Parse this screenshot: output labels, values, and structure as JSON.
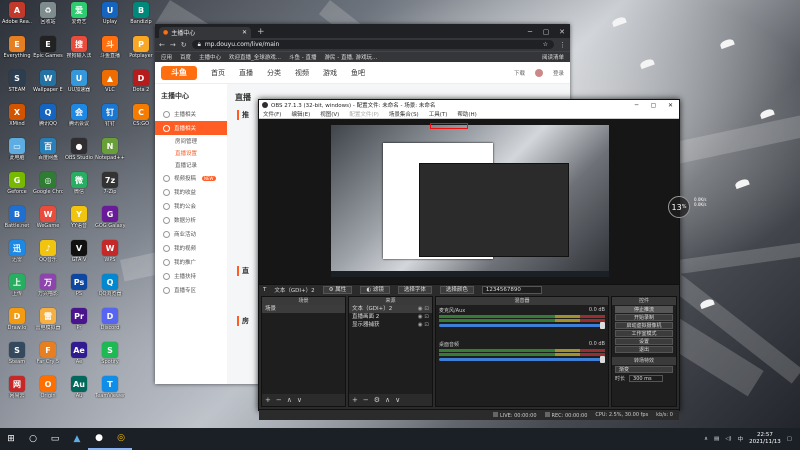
{
  "desktop": {
    "icons": [
      {
        "label": "Adobe Rea...",
        "color": "#c0392b",
        "glyph": "A"
      },
      {
        "label": "Everything",
        "color": "#e67e22",
        "glyph": "E"
      },
      {
        "label": "STEAM",
        "color": "#2c3e50",
        "glyph": "S"
      },
      {
        "label": "XMind",
        "color": "#d35400",
        "glyph": "X"
      },
      {
        "label": "此电脑",
        "color": "#5dade2",
        "glyph": "▭"
      },
      {
        "label": "Geforce",
        "color": "#76b900",
        "glyph": "G"
      },
      {
        "label": "Battle.net",
        "color": "#1f6fd1",
        "glyph": "B"
      },
      {
        "label": "迅雷",
        "color": "#1e88e5",
        "glyph": "迅"
      },
      {
        "label": "上传",
        "color": "#27ae60",
        "glyph": "上"
      },
      {
        "label": "Draw.io",
        "color": "#f39c12",
        "glyph": "D"
      },
      {
        "label": "Steam",
        "color": "#34495e",
        "glyph": "S"
      },
      {
        "label": "网易云",
        "color": "#c62828",
        "glyph": "网"
      },
      {
        "label": "回收站",
        "color": "#7f8c8d",
        "glyph": "♻"
      },
      {
        "label": "Epic Games",
        "color": "#222",
        "glyph": "E"
      },
      {
        "label": "Wallpaper Engine",
        "color": "#2471a3",
        "glyph": "W"
      },
      {
        "label": "腾讯QQ",
        "color": "#1565c0",
        "glyph": "Q"
      },
      {
        "label": "百度网盘",
        "color": "#2980b9",
        "glyph": "百"
      },
      {
        "label": "Google Chrome",
        "color": "#2e7d32",
        "glyph": "◎"
      },
      {
        "label": "WeGame",
        "color": "#e74c3c",
        "glyph": "W"
      },
      {
        "label": "QQ音乐",
        "color": "#f1c40f",
        "glyph": "♪"
      },
      {
        "label": "万兴喵影",
        "color": "#8e44ad",
        "glyph": "万"
      },
      {
        "label": "雷电模拟器",
        "color": "#f5b041",
        "glyph": "雷"
      },
      {
        "label": "Far Cry 5",
        "color": "#e67e22",
        "glyph": "F"
      },
      {
        "label": "Origin",
        "color": "#ff6f00",
        "glyph": "O"
      },
      {
        "label": "爱奇艺",
        "color": "#2ecc71",
        "glyph": "爱"
      },
      {
        "label": "搜狗输入法",
        "color": "#e74c3c",
        "glyph": "搜"
      },
      {
        "label": "UU加速器",
        "color": "#3498db",
        "glyph": "U"
      },
      {
        "label": "腾讯会议",
        "color": "#1e88e5",
        "glyph": "会"
      },
      {
        "label": "OBS Studio",
        "color": "#302e31",
        "glyph": "●"
      },
      {
        "label": "微信",
        "color": "#27ae60",
        "glyph": "微"
      },
      {
        "label": "YY语音",
        "color": "#f1c40f",
        "glyph": "Y"
      },
      {
        "label": "GTA V",
        "color": "#111",
        "glyph": "V"
      },
      {
        "label": "PS",
        "color": "#0d47a1",
        "glyph": "Ps"
      },
      {
        "label": "Pr",
        "color": "#4a148c",
        "glyph": "Pr"
      },
      {
        "label": "Ae",
        "color": "#311b92",
        "glyph": "Ae"
      },
      {
        "label": "Au",
        "color": "#00695c",
        "glyph": "Au"
      },
      {
        "label": "Uplay",
        "color": "#1565c0",
        "glyph": "U"
      },
      {
        "label": "斗鱼直播",
        "color": "#ff6f0f",
        "glyph": "斗"
      },
      {
        "label": "VLC",
        "color": "#ef6c00",
        "glyph": "▲"
      },
      {
        "label": "钉钉",
        "color": "#1976d2",
        "glyph": "钉"
      },
      {
        "label": "Notepad++",
        "color": "#689f38",
        "glyph": "N"
      },
      {
        "label": "7-Zip",
        "color": "#333",
        "glyph": "7z"
      },
      {
        "label": "GOG Galaxy",
        "color": "#6a1b9a",
        "glyph": "G"
      },
      {
        "label": "WPS",
        "color": "#c62828",
        "glyph": "W"
      },
      {
        "label": "QQ浏览器",
        "color": "#0288d1",
        "glyph": "Q"
      },
      {
        "label": "Discord",
        "color": "#5865f2",
        "glyph": "D"
      },
      {
        "label": "Spotify",
        "color": "#1db954",
        "glyph": "S"
      },
      {
        "label": "TeamViewer",
        "color": "#0e8ee9",
        "glyph": "T"
      },
      {
        "label": "Bandizip",
        "color": "#00897b",
        "glyph": "B"
      },
      {
        "label": "Potplayer",
        "color": "#f9a825",
        "glyph": "P"
      },
      {
        "label": "Dota 2",
        "color": "#b71c1c",
        "glyph": "D"
      },
      {
        "label": "CS:GO",
        "color": "#f57c00",
        "glyph": "C"
      }
    ]
  },
  "chrome": {
    "tab_title": "主播中心",
    "new_tab": "+",
    "url": "mp.douyu.com/live/main",
    "bookmarks": [
      "应用",
      "百度",
      "主播中心",
      "欢迎直播_全球游戏...",
      "斗鱼 - 直播",
      "游民 - 直播, 游戏玩..."
    ],
    "bookmark_more": "阅读清单",
    "site": {
      "logo": "斗鱼",
      "logo_sub": "DOUYU.COM",
      "nav": [
        "首页",
        "直播",
        "分类",
        "视频",
        "游戏",
        "鱼吧"
      ],
      "nav_right": [
        "下载",
        "登录"
      ],
      "sidebar_title": "主播中心",
      "sidebar_items": [
        {
          "label": "主播相关",
          "active": false
        },
        {
          "label": "直播相关",
          "active": true
        }
      ],
      "sidebar_subs": [
        {
          "label": "房间管理",
          "active": false
        },
        {
          "label": "直播设置",
          "active": true
        },
        {
          "label": "直播记录",
          "active": false
        }
      ],
      "sidebar_more": [
        {
          "label": "视频投稿",
          "badge": "NEW"
        },
        {
          "label": "我的收益",
          "badge": ""
        },
        {
          "label": "我的公会",
          "badge": ""
        },
        {
          "label": "数据分析",
          "badge": ""
        },
        {
          "label": "商业活动",
          "badge": ""
        },
        {
          "label": "我的视频",
          "badge": ""
        },
        {
          "label": "我的推广",
          "badge": ""
        },
        {
          "label": "主播扶持",
          "badge": ""
        },
        {
          "label": "直播专区",
          "badge": ""
        }
      ],
      "main_title": "直播",
      "section_1": "推",
      "section_2": "直",
      "section_3": "房"
    }
  },
  "obs": {
    "title": "OBS 27.1.3 (32-bit, windows) - 配置文件: 未命名 - 场景: 未命名",
    "menus": [
      {
        "label": "文件(F)",
        "disabled": false
      },
      {
        "label": "编辑(E)",
        "disabled": false
      },
      {
        "label": "视图(V)",
        "disabled": false
      },
      {
        "label": "配置文件(P)",
        "disabled": true
      },
      {
        "label": "场景集合(S)",
        "disabled": false
      },
      {
        "label": "工具(T)",
        "disabled": false
      },
      {
        "label": "帮助(H)",
        "disabled": false
      }
    ],
    "source_bar": {
      "source_label": "文本（GDI+）2",
      "properties": "属性",
      "filters": "滤镜",
      "text_label": "选择字体",
      "select_color": "选择颜色",
      "text_value": "1234567890"
    },
    "docks": {
      "scenes_title": "场景",
      "scenes": [
        "场景"
      ],
      "sources_title": "来源",
      "sources": [
        "文本（GDI+）2",
        "直播画面 2",
        "显示器捕获"
      ],
      "mixer_title": "混音器",
      "mixer": [
        {
          "name": "麦克风/Aux",
          "db": "0.0 dB"
        },
        {
          "name": "桌面音频",
          "db": "0.0 dB"
        }
      ],
      "controls_title": "控件",
      "controls": [
        "停止推流",
        "开始录制",
        "启动虚拟摄像机",
        "工作室模式",
        "设置",
        "退出"
      ],
      "transitions_title": "转场特效",
      "transition_type": "渐变",
      "duration_label": "时长",
      "duration_value": "300 ms"
    },
    "status": {
      "live": "LIVE: 00:00:00",
      "rec": "REC: 00:00:00",
      "cpu": "CPU: 2.5%, 30.00 fps",
      "bitrate": "kb/s: 0"
    }
  },
  "float_widget": {
    "value": "13",
    "unit": "%",
    "up": "0.0K/s",
    "down": "0.0K/s"
  },
  "taskbar": {
    "time": "22:57",
    "date": "2021/11/13",
    "lang": "中",
    "open_apps": [
      "OBS",
      "Chrome"
    ]
  }
}
